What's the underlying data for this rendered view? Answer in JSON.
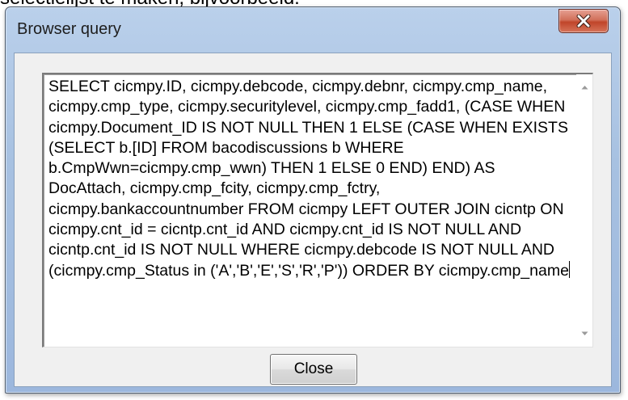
{
  "background": {
    "text": "selectielijst te maken, bijvoorbeeld:"
  },
  "dialog": {
    "title": "Browser query",
    "title_close_icon": "close-x-icon",
    "sql_text": "SELECT cicmpy.ID, cicmpy.debcode, cicmpy.debnr, cicmpy.cmp_name, cicmpy.cmp_type, cicmpy.securitylevel, cicmpy.cmp_fadd1, (CASE WHEN cicmpy.Document_ID IS NOT NULL THEN 1 ELSE (CASE WHEN EXISTS (SELECT b.[ID] FROM bacodiscussions b WHERE b.CmpWwn=cicmpy.cmp_wwn) THEN 1 ELSE 0 END) END) AS DocAttach, cicmpy.cmp_fcity, cicmpy.cmp_fctry, cicmpy.bankaccountnumber FROM cicmpy  LEFT OUTER JOIN cicntp ON cicmpy.cnt_id = cicntp.cnt_id AND cicmpy.cnt_id IS NOT NULL AND cicntp.cnt_id IS NOT NULL WHERE cicmpy.debcode IS NOT NULL AND (cicmpy.cmp_Status in ('A','B','E','S','R','P')) ORDER BY cicmpy.cmp_name",
    "scroll_up_icon": "scroll-up-arrow-icon",
    "scroll_down_icon": "scroll-down-arrow-icon",
    "close_button_label": "Close"
  },
  "colors": {
    "frame": "#a7c1e1",
    "close_button_red": "#c0452a",
    "client_bg": "#f0f0f0"
  }
}
